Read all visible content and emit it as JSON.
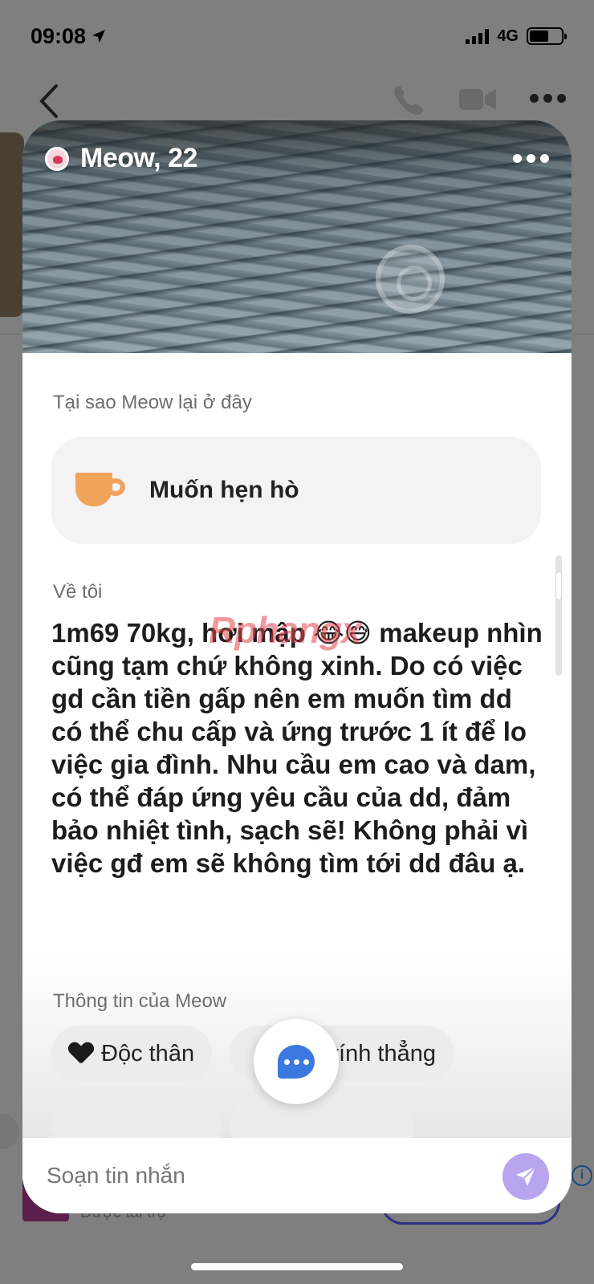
{
  "status_bar": {
    "time": "09:08",
    "network": "4G"
  },
  "profile": {
    "name_age": "Meow, 22"
  },
  "reason": {
    "label": "Tại sao Meow lại ở đây",
    "value": "Muốn hẹn hò",
    "icon": "cup-icon"
  },
  "about": {
    "label": "Về tôi",
    "text": "1m69 70kg, hơi mập 😂😅 makeup nhìn cũng tạm chứ không xinh. Do có việc gd cần tiền gấp nên em muốn tìm dd có thể chu cấp và ứng trước 1 ít để lo việc gia đình. Nhu cầu em cao và dam, có thể đáp ứng yêu cầu của dd, đảm bảo nhiệt tình, sạch sẽ! Không phải vì việc gđ em sẽ không tìm tới dd đâu ạ."
  },
  "info": {
    "label": "Thông tin của Meow",
    "chips": [
      "Độc thân",
      "tính thẳng"
    ]
  },
  "compose": {
    "placeholder": "Soạn tin nhắn"
  },
  "watermark": "Rphangx",
  "background_ad": {
    "sponsored": "Được tài trợ"
  },
  "colors": {
    "overlay": "#7f7f7f",
    "send_button": "#b9a4f0",
    "chat_icon": "#3b78e0",
    "cup": "#f0a35c"
  }
}
